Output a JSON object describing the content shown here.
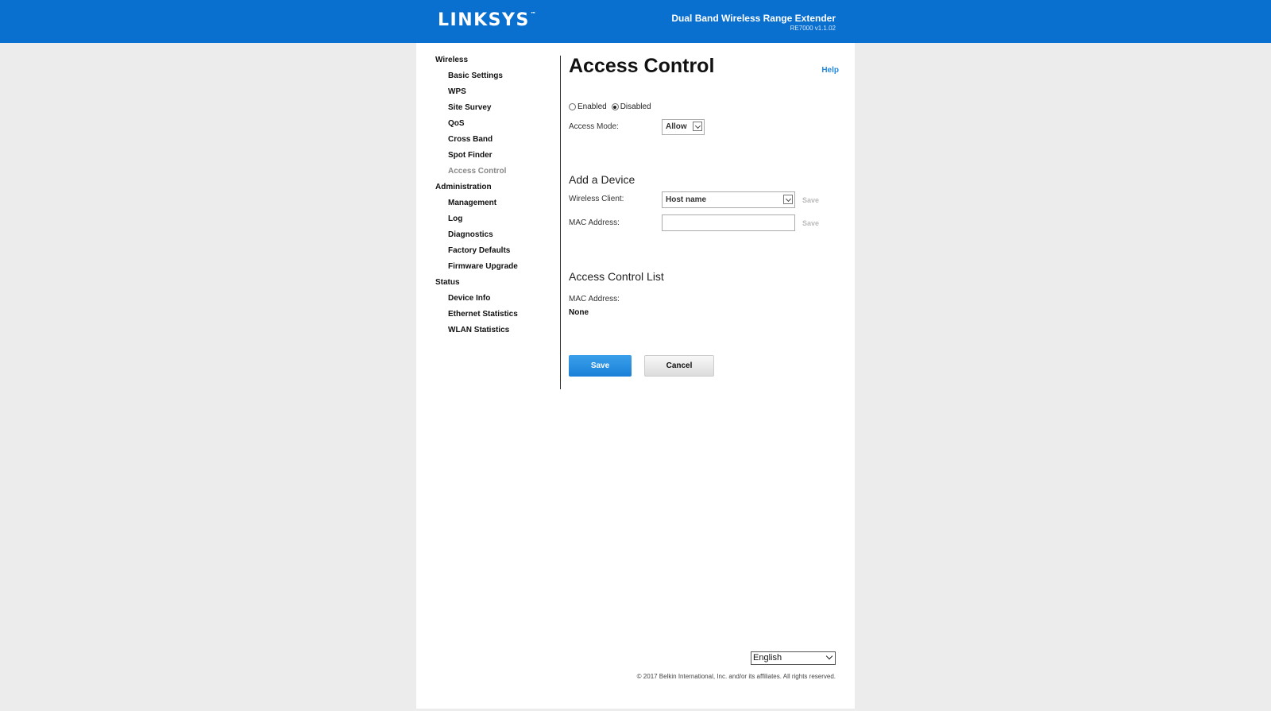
{
  "header": {
    "logo_text": "LINKSYS",
    "logo_tm": "™",
    "product_name": "Dual Band Wireless Range Extender",
    "version": "RE7000 v1.1.02"
  },
  "sidebar": {
    "groups": [
      {
        "label": "Wireless",
        "items": [
          "Basic Settings",
          "WPS",
          "Site Survey",
          "QoS",
          "Cross Band",
          "Spot Finder",
          "Access Control"
        ]
      },
      {
        "label": "Administration",
        "items": [
          "Management",
          "Log",
          "Diagnostics",
          "Factory Defaults",
          "Firmware Upgrade"
        ]
      },
      {
        "label": "Status",
        "items": [
          "Device Info",
          "Ethernet Statistics",
          "WLAN Statistics"
        ]
      }
    ],
    "active_item": "Access Control"
  },
  "main": {
    "title": "Access Control",
    "help_label": "Help",
    "enabled_label": "Enabled",
    "disabled_label": "Disabled",
    "selected_state": "Disabled",
    "access_mode_label": "Access Mode:",
    "access_mode_value": "Allow",
    "add_device_title": "Add a Device",
    "wireless_client_label": "Wireless Client:",
    "wireless_client_value": "Host name",
    "mac_address_label": "MAC Address:",
    "mac_address_value": "",
    "row_save_label": "Save",
    "acl_title": "Access Control List",
    "acl_mac_label": "MAC Address:",
    "acl_value": "None",
    "save_button": "Save",
    "cancel_button": "Cancel"
  },
  "footer": {
    "language": "English",
    "copyright": "© 2017 Belkin International, Inc. and/or its affiliates. All rights reserved."
  },
  "colors": {
    "brand_blue": "#0a70d0",
    "save_button_blue": "#1a80d8",
    "link_blue": "#2288dd"
  }
}
